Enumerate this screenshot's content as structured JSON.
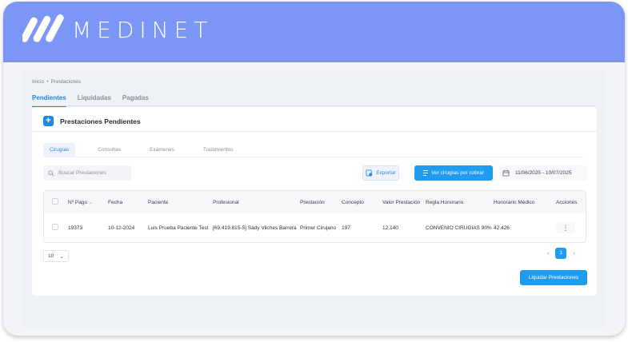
{
  "app": {
    "brand": "MEDINET",
    "brand_color": "#7b96f5",
    "accent": "#1f88e5"
  },
  "breadcrumb": [
    "Inicio",
    "Prestaciones"
  ],
  "top_tabs": [
    {
      "label": "Pendientes",
      "active": true
    },
    {
      "label": "Liquidadas",
      "active": false
    },
    {
      "label": "Pagadas",
      "active": false
    }
  ],
  "card": {
    "title": "Prestaciones Pendientes",
    "title_icon": "plus-icon"
  },
  "sub_tabs": [
    {
      "label": "Cirugías",
      "active": true
    },
    {
      "label": "Consultas",
      "active": false
    },
    {
      "label": "Exámenes",
      "active": false
    },
    {
      "label": "Tratamientos",
      "active": false
    }
  ],
  "search": {
    "placeholder": "Buscar Prestaciones",
    "icon": "search-icon"
  },
  "toolbar": {
    "export_label": "Exportar",
    "ver_label": "Ver cirugías por cobrar",
    "date_range": "11/06/2025 - 10/07/2025"
  },
  "table": {
    "columns": [
      "Nº Pago",
      "Fecha",
      "Paciente",
      "Profesional",
      "Prestación",
      "Concepto",
      "Valor Prestación",
      "Regla Honorario",
      "Honorario Médico",
      "Acciones"
    ],
    "rows": [
      {
        "pago": "19373",
        "fecha": "10-12-2024",
        "paciente": "Luis Prueba Paciente Test",
        "profesional": "[69.419.815-5] Sady Vilches Barrera",
        "prestacion": "Primer Cirujano",
        "concepto": "197",
        "valor": "12.140",
        "regla": "CONVENIO CIRUGIAS 90%",
        "honorario": "42.426",
        "acciones": "⋮"
      }
    ]
  },
  "pagination": {
    "page_size": "10",
    "current_page": "1",
    "prev": "‹",
    "next": "›"
  },
  "footer": {
    "liquidar_label": "Liquidar Prestaciones"
  }
}
